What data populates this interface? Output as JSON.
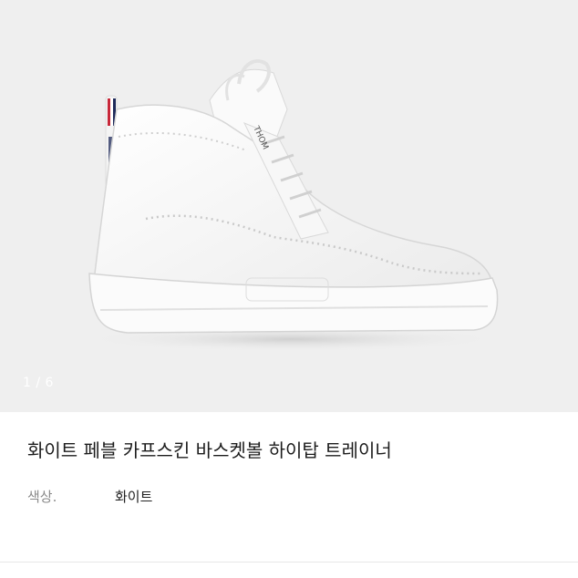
{
  "gallery": {
    "image_icon": "sneaker-image",
    "counter": "1 / 6"
  },
  "product": {
    "title": "화이트 페블 카프스킨 바스켓볼 하이탑 트레이너",
    "color_label": "색상.",
    "color_value": "화이트"
  },
  "colors": {
    "gallery_bg": "#efefef",
    "tab_red": "#c8283a",
    "tab_navy": "#1e2a5a"
  }
}
